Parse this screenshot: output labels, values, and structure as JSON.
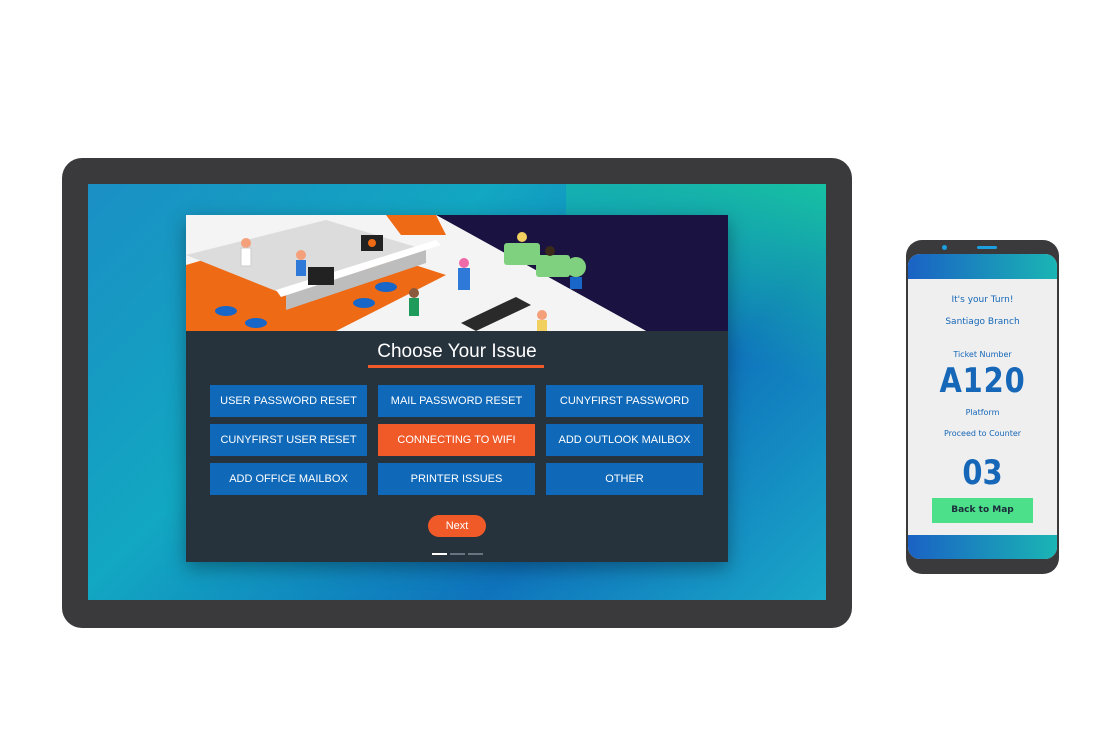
{
  "kiosk": {
    "title": "Choose Your Issue",
    "issues": [
      {
        "label": "USER PASSWORD RESET",
        "selected": false
      },
      {
        "label": "MAIL PASSWORD RESET",
        "selected": false
      },
      {
        "label": "CUNYFIRST PASSWORD",
        "selected": false
      },
      {
        "label": "CUNYFIRST USER RESET",
        "selected": false
      },
      {
        "label": "CONNECTING TO WIFI",
        "selected": true
      },
      {
        "label": "ADD OUTLOOK MAILBOX",
        "selected": false
      },
      {
        "label": "ADD OFFICE MAILBOX",
        "selected": false
      },
      {
        "label": "PRINTER ISSUES",
        "selected": false
      },
      {
        "label": "OTHER",
        "selected": false
      }
    ],
    "next_label": "Next",
    "pager": {
      "pages": 3,
      "active": 1
    }
  },
  "phone": {
    "turn_text": "It's your Turn!",
    "branch": "Santiago Branch",
    "ticket_label": "Ticket Number",
    "ticket_number": "A120",
    "platform_label": "Platform",
    "proceed_text": "Proceed to Counter",
    "counter_number": "03",
    "back_label": "Back to Map"
  },
  "colors": {
    "accent_orange": "#f05a28",
    "button_blue": "#0f69b8",
    "card_dark": "#26323c",
    "back_green": "#4ce08a"
  }
}
